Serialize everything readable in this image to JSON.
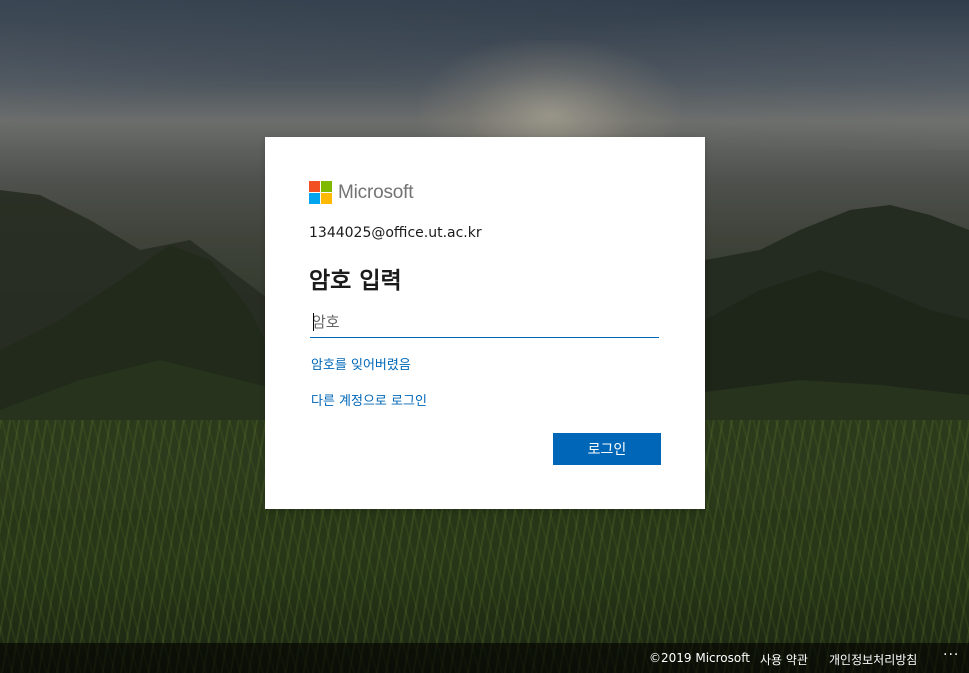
{
  "card": {
    "logo_text": "Microsoft",
    "logo_colors": [
      "#f25022",
      "#7fba00",
      "#00a4ef",
      "#ffb900"
    ],
    "email": "1344025@office.ut.ac.kr",
    "title": "암호 입력",
    "password_placeholder": "암호",
    "forgot_link": "암호를 잊어버렸음",
    "other_account_link": "다른 계정으로 로그인",
    "signin_button": "로그인"
  },
  "footer": {
    "copyright": "©2019 Microsoft",
    "terms": "사용 약관",
    "privacy": "개인정보처리방침",
    "more": "···"
  },
  "colors": {
    "accent": "#0067b8",
    "text": "#1b1b1b"
  }
}
